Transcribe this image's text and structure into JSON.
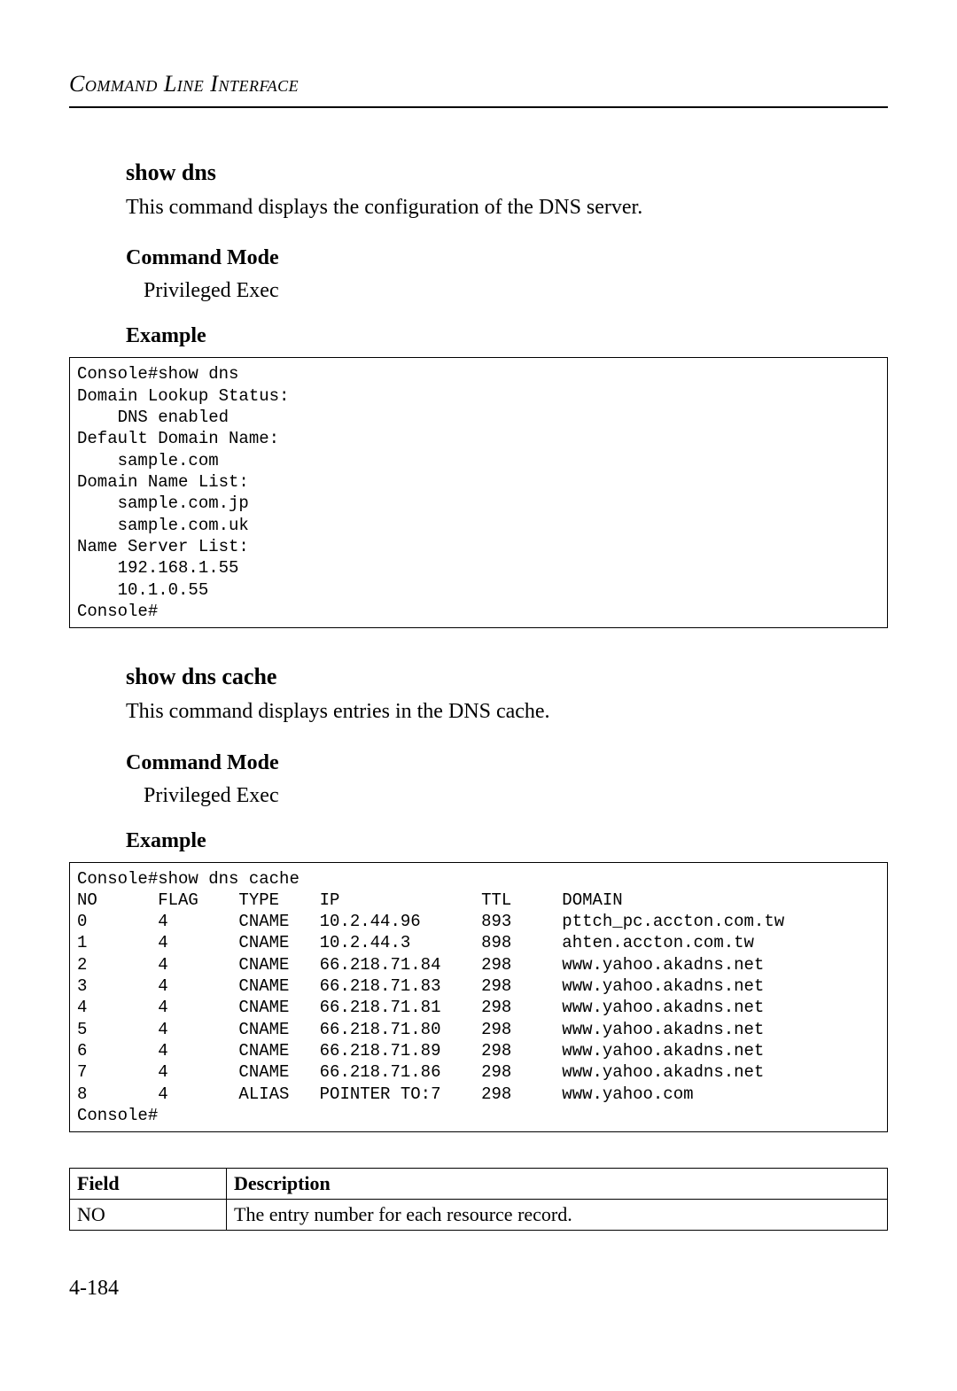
{
  "header": {
    "running_head": "Command Line Interface"
  },
  "section1": {
    "command": "show dns",
    "description": "This command displays the configuration of the DNS server.",
    "mode_heading": "Command Mode",
    "mode_value": "Privileged Exec",
    "example_heading": "Example",
    "console": "Console#show dns\nDomain Lookup Status:\n    DNS enabled\nDefault Domain Name:\n    sample.com\nDomain Name List:\n    sample.com.jp\n    sample.com.uk\nName Server List:\n    192.168.1.55\n    10.1.0.55\nConsole#"
  },
  "section2": {
    "command": "show dns cache",
    "description": "This command displays entries in the DNS cache.",
    "mode_heading": "Command Mode",
    "mode_value": "Privileged Exec",
    "example_heading": "Example",
    "console": "Console#show dns cache\nNO      FLAG    TYPE    IP              TTL     DOMAIN\n0       4       CNAME   10.2.44.96      893     pttch_pc.accton.com.tw\n1       4       CNAME   10.2.44.3       898     ahten.accton.com.tw\n2       4       CNAME   66.218.71.84    298     www.yahoo.akadns.net\n3       4       CNAME   66.218.71.83    298     www.yahoo.akadns.net\n4       4       CNAME   66.218.71.81    298     www.yahoo.akadns.net\n5       4       CNAME   66.218.71.80    298     www.yahoo.akadns.net\n6       4       CNAME   66.218.71.89    298     www.yahoo.akadns.net\n7       4       CNAME   66.218.71.86    298     www.yahoo.akadns.net\n8       4       ALIAS   POINTER TO:7    298     www.yahoo.com\nConsole#"
  },
  "field_table": {
    "head_field": "Field",
    "head_desc": "Description",
    "rows": [
      {
        "field": "NO",
        "desc": "The entry number for each resource record."
      }
    ]
  },
  "page_number": "4-184"
}
